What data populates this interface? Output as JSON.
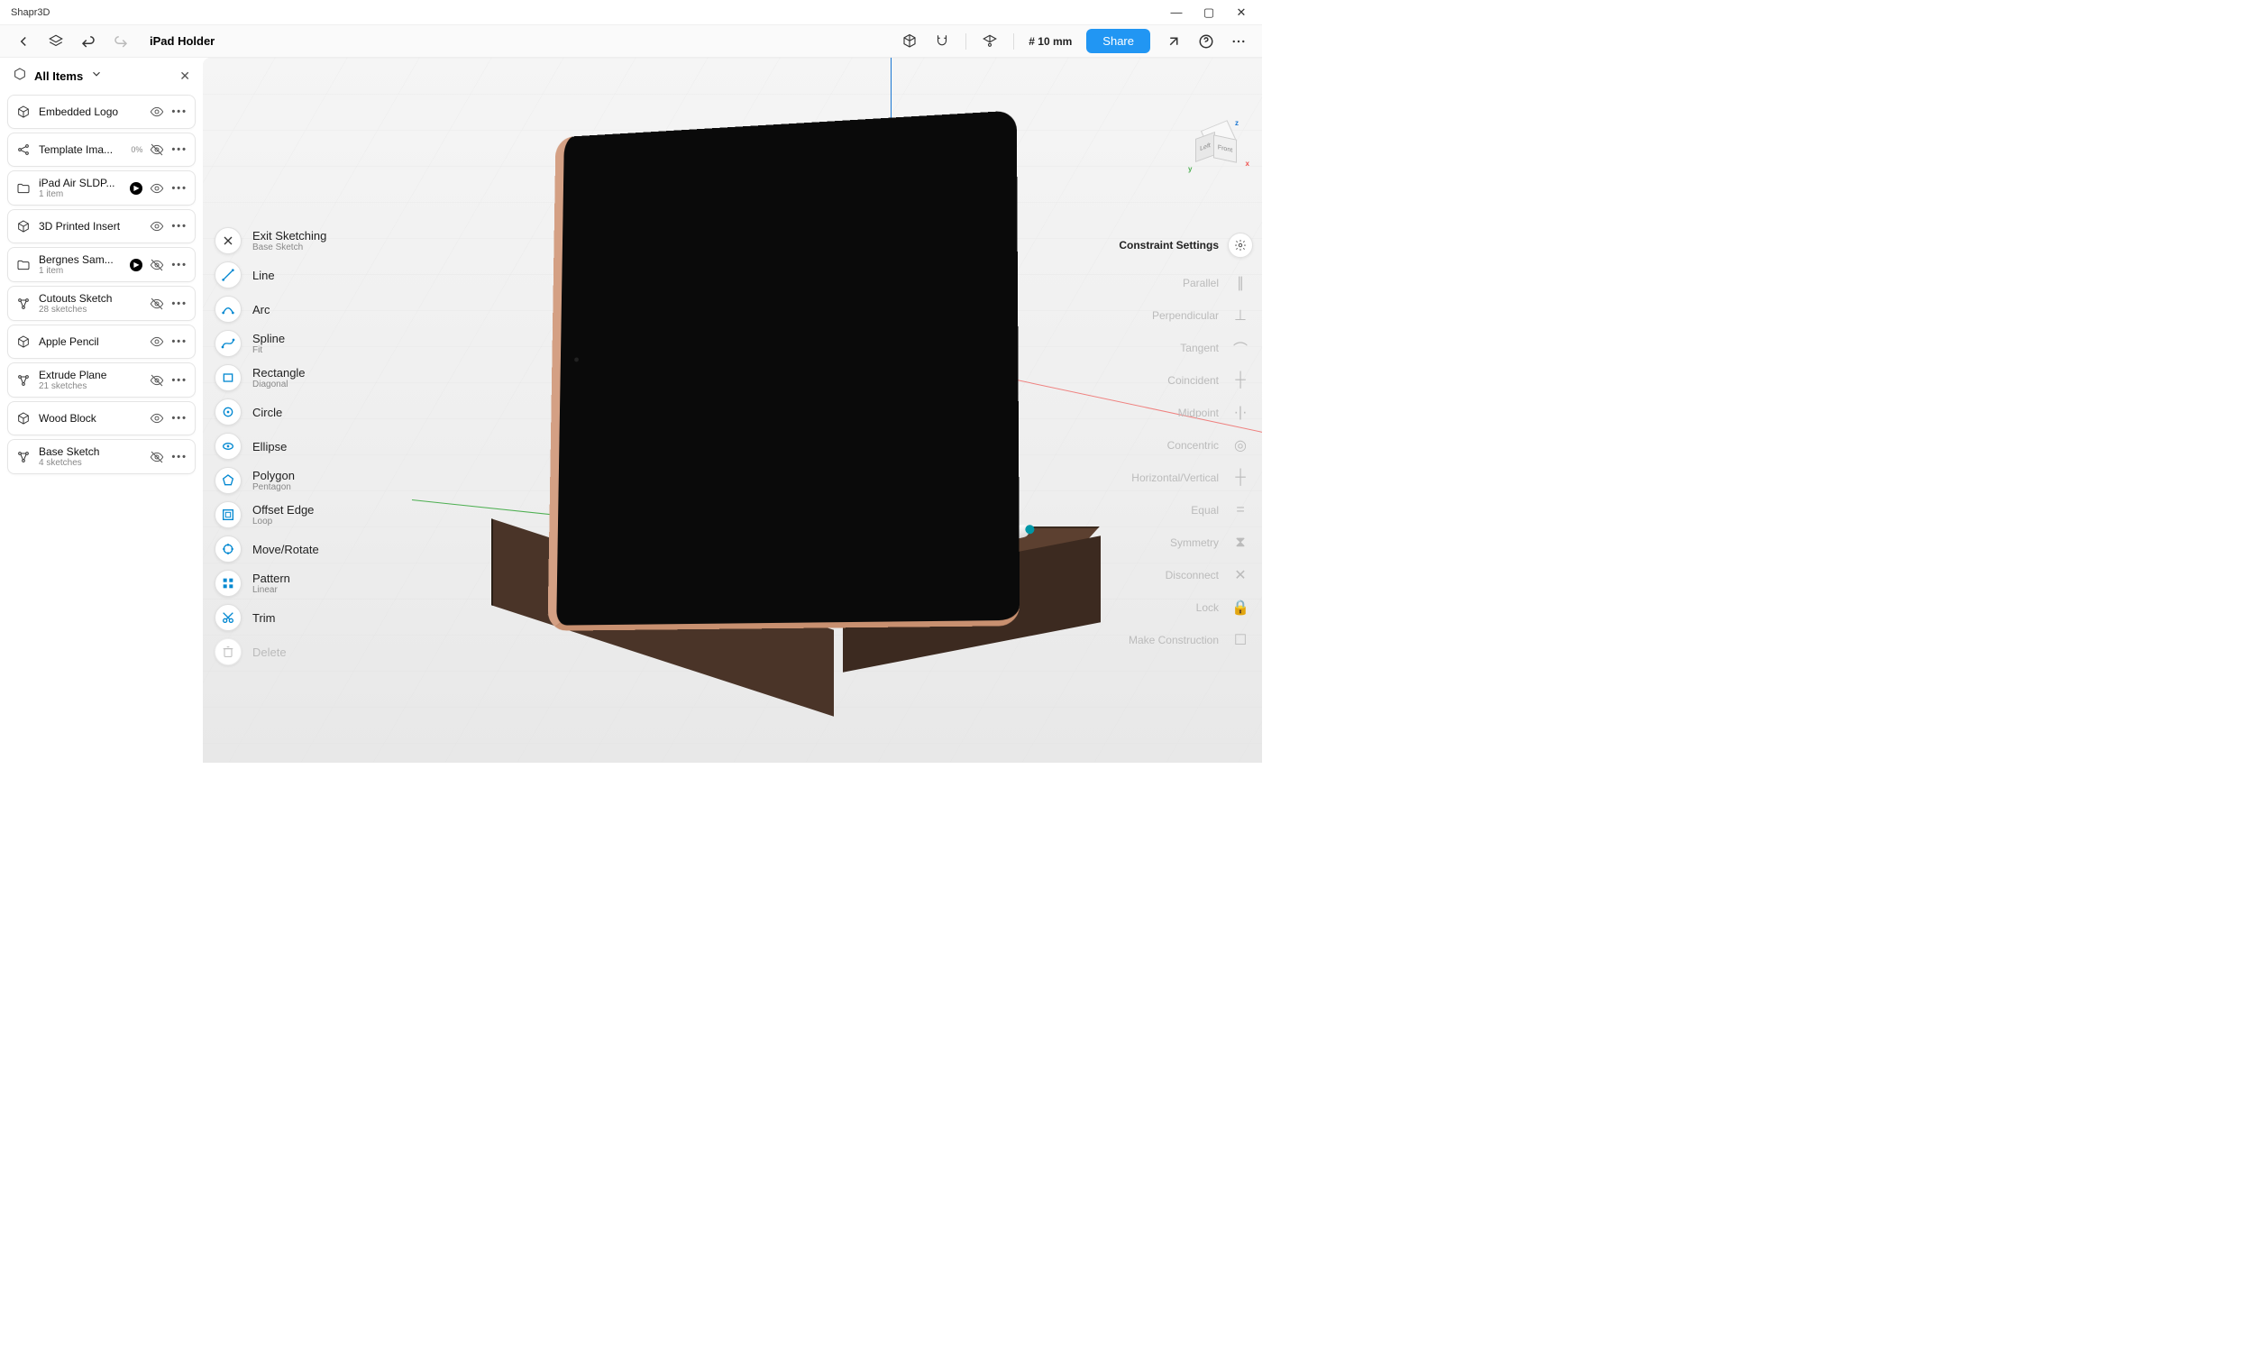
{
  "window": {
    "title": "Shapr3D",
    "minimize": "—",
    "maximize": "▢",
    "close": "✕"
  },
  "toolbar": {
    "project_title": "iPad Holder",
    "grid_value": "# 10 mm",
    "share_label": "Share"
  },
  "panel": {
    "title": "All Items"
  },
  "items": [
    {
      "icon": "body",
      "label": "Embedded Logo",
      "sub": "",
      "badge": "",
      "expand": false,
      "visible": true
    },
    {
      "icon": "share",
      "label": "Template Ima...",
      "sub": "",
      "badge": "0%",
      "expand": false,
      "visible": false
    },
    {
      "icon": "folder",
      "label": "iPad Air SLDP...",
      "sub": "1 item",
      "badge": "",
      "expand": true,
      "visible": true
    },
    {
      "icon": "body",
      "label": "3D Printed Insert",
      "sub": "",
      "badge": "",
      "expand": false,
      "visible": true
    },
    {
      "icon": "folder",
      "label": "Bergnes Sam...",
      "sub": "1 item",
      "badge": "",
      "expand": true,
      "visible": false
    },
    {
      "icon": "sketch",
      "label": "Cutouts Sketch",
      "sub": "28 sketches",
      "badge": "",
      "expand": false,
      "visible": false
    },
    {
      "icon": "body",
      "label": "Apple Pencil",
      "sub": "",
      "badge": "",
      "expand": false,
      "visible": true
    },
    {
      "icon": "sketch",
      "label": "Extrude Plane",
      "sub": "21 sketches",
      "badge": "",
      "expand": false,
      "visible": false
    },
    {
      "icon": "body",
      "label": "Wood Block",
      "sub": "",
      "badge": "",
      "expand": false,
      "visible": true
    },
    {
      "icon": "sketch",
      "label": "Base Sketch",
      "sub": "4 sketches",
      "badge": "",
      "expand": false,
      "visible": false
    }
  ],
  "sketch_tools": [
    {
      "label": "Exit Sketching",
      "sub": "Base Sketch",
      "disabled": false,
      "icon": "x"
    },
    {
      "label": "Line",
      "sub": "",
      "disabled": false,
      "icon": "line"
    },
    {
      "label": "Arc",
      "sub": "",
      "disabled": false,
      "icon": "arc"
    },
    {
      "label": "Spline",
      "sub": "Fit",
      "disabled": false,
      "icon": "spline"
    },
    {
      "label": "Rectangle",
      "sub": "Diagonal",
      "disabled": false,
      "icon": "rect"
    },
    {
      "label": "Circle",
      "sub": "",
      "disabled": false,
      "icon": "circle"
    },
    {
      "label": "Ellipse",
      "sub": "",
      "disabled": false,
      "icon": "ellipse"
    },
    {
      "label": "Polygon",
      "sub": "Pentagon",
      "disabled": false,
      "icon": "polygon"
    },
    {
      "label": "Offset Edge",
      "sub": "Loop",
      "disabled": false,
      "icon": "offset"
    },
    {
      "label": "Move/Rotate",
      "sub": "",
      "disabled": false,
      "icon": "move"
    },
    {
      "label": "Pattern",
      "sub": "Linear",
      "disabled": false,
      "icon": "pattern"
    },
    {
      "label": "Trim",
      "sub": "",
      "disabled": false,
      "icon": "trim"
    },
    {
      "label": "Delete",
      "sub": "",
      "disabled": true,
      "icon": "delete"
    }
  ],
  "constraints": {
    "title": "Constraint Settings",
    "items": [
      "Parallel",
      "Perpendicular",
      "Tangent",
      "Coincident",
      "Midpoint",
      "Concentric",
      "Horizontal/Vertical",
      "Equal",
      "Symmetry",
      "Disconnect",
      "Lock",
      "Make Construction"
    ]
  },
  "cube": {
    "front": "Front",
    "left": "Left",
    "top": "",
    "z": "z",
    "y": "y",
    "x": "x"
  }
}
